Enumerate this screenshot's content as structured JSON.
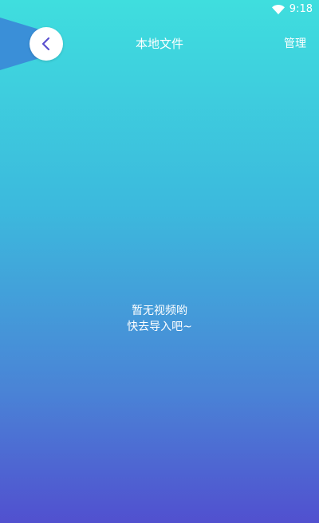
{
  "status_bar": {
    "time": "9:18",
    "icons": [
      "wifi-icon"
    ]
  },
  "header": {
    "back_icon": "chevron-left-icon",
    "title": "本地文件",
    "manage_label": "管理"
  },
  "empty_state": {
    "line1": "暂无视频哟",
    "line2": "快去导入吧~"
  },
  "colors": {
    "gradient_top": "#3fdede",
    "gradient_bottom": "#5150cf",
    "back_tab": "#3a8fd8",
    "back_icon": "#5a4fcf",
    "text": "#ffffff"
  }
}
